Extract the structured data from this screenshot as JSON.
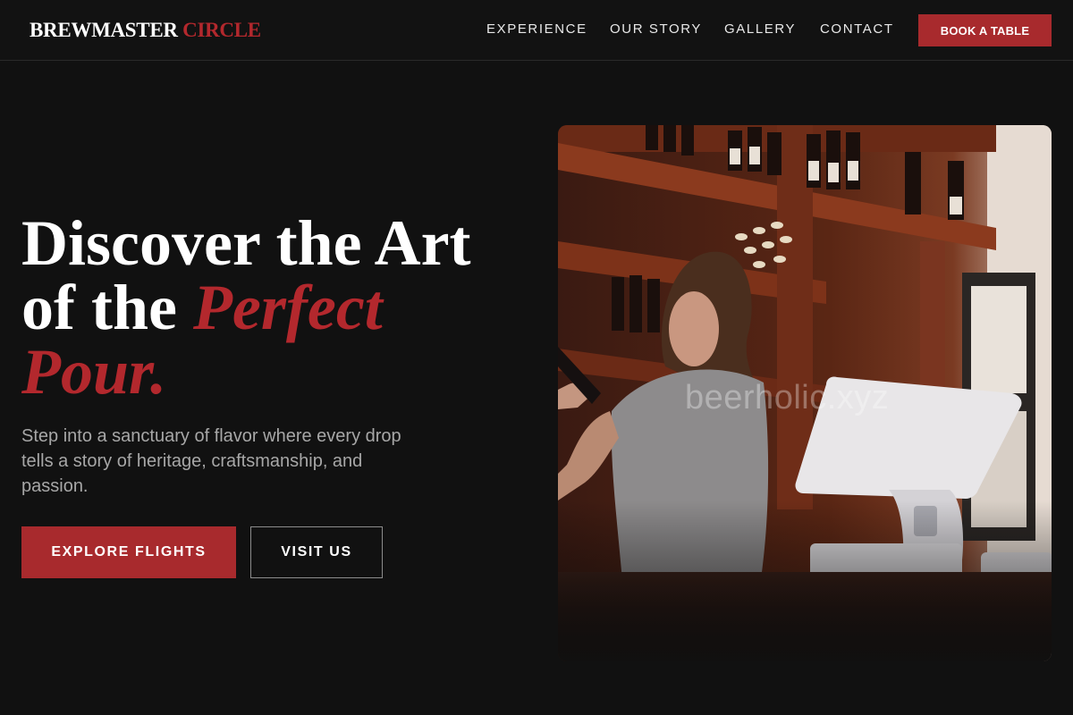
{
  "header": {
    "logo_main": "BREWMASTER",
    "logo_accent": "CIRCLE",
    "nav": {
      "experience": "EXPERIENCE",
      "our_story": "OUR STORY",
      "gallery": "GALLERY",
      "contact": "CONTACT"
    },
    "cta_label": "BOOK A TABLE"
  },
  "hero": {
    "title_line1": "Discover the Art",
    "title_line2_plain": "of the ",
    "title_line2_accent": "Perfect",
    "title_line3_accent": "Pour.",
    "subtitle": "Step into a sanctuary of flavor where every drop tells a story of heritage, craftsmanship, and passion.",
    "primary_button": "EXPLORE FLIGHTS",
    "secondary_button": "VISIT US"
  },
  "image": {
    "watermark": "beerholic.xyz"
  },
  "colors": {
    "background": "#111111",
    "accent": "#a82a2d",
    "text_muted": "#a7a7a7"
  }
}
